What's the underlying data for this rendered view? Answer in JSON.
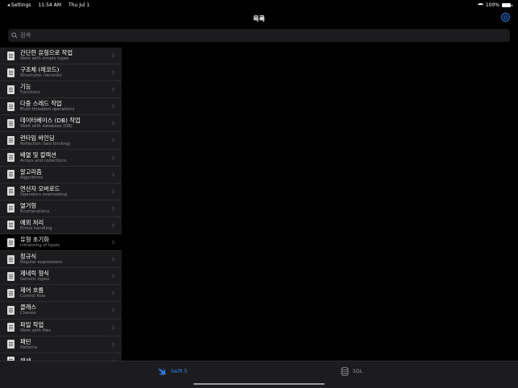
{
  "status": {
    "back_label": "◂ Settings",
    "time": "11:54 AM",
    "date": "Thu Jul 1",
    "battery_text": "100%",
    "battery_level": 1.0
  },
  "nav": {
    "title": "목록",
    "settings_icon": "gear-icon"
  },
  "search": {
    "placeholder": "검색"
  },
  "list": [
    {
      "title": "간단한 유형으로 작업",
      "subtitle": "Work with simple types"
    },
    {
      "title": "구조체 (레코드)",
      "subtitle": "Structures (records)"
    },
    {
      "title": "기능",
      "subtitle": "Functions"
    },
    {
      "title": "다중 스레드 작업",
      "subtitle": "Multi-threaded operations"
    },
    {
      "title": "데이터베이스 (DB) 작업",
      "subtitle": "Work with database (DB)"
    },
    {
      "title": "런타임 바인딩",
      "subtitle": "Reflection (late binding)"
    },
    {
      "title": "배열 및 컬렉션",
      "subtitle": "Arrays and collections"
    },
    {
      "title": "알고리즘",
      "subtitle": "Algorithms"
    },
    {
      "title": "연산자 오버로드",
      "subtitle": "Operators overloading"
    },
    {
      "title": "열거형",
      "subtitle": "Enumerations"
    },
    {
      "title": "예외 처리",
      "subtitle": "Errors handling"
    },
    {
      "title": "유형 초기화",
      "subtitle": "Initializing of types"
    },
    {
      "title": "정규식",
      "subtitle": "Regular expressions"
    },
    {
      "title": "제네릭 형식",
      "subtitle": "Generic types"
    },
    {
      "title": "제어 흐름",
      "subtitle": "Control flow"
    },
    {
      "title": "클래스",
      "subtitle": "Classes"
    },
    {
      "title": "파일 작업",
      "subtitle": "Work with files"
    },
    {
      "title": "패턴",
      "subtitle": "Patterns"
    },
    {
      "title": "패쌔",
      "subtitle": ""
    }
  ],
  "selected_index": 11,
  "tabs": [
    {
      "label": "Swift 5",
      "icon": "swift-icon",
      "active": true
    },
    {
      "label": "SQL",
      "icon": "database-icon",
      "active": false
    }
  ],
  "colors": {
    "accent": "#2f80ed",
    "sidebar_bg": "#1c1c1e",
    "selected_bg": "#000000"
  }
}
